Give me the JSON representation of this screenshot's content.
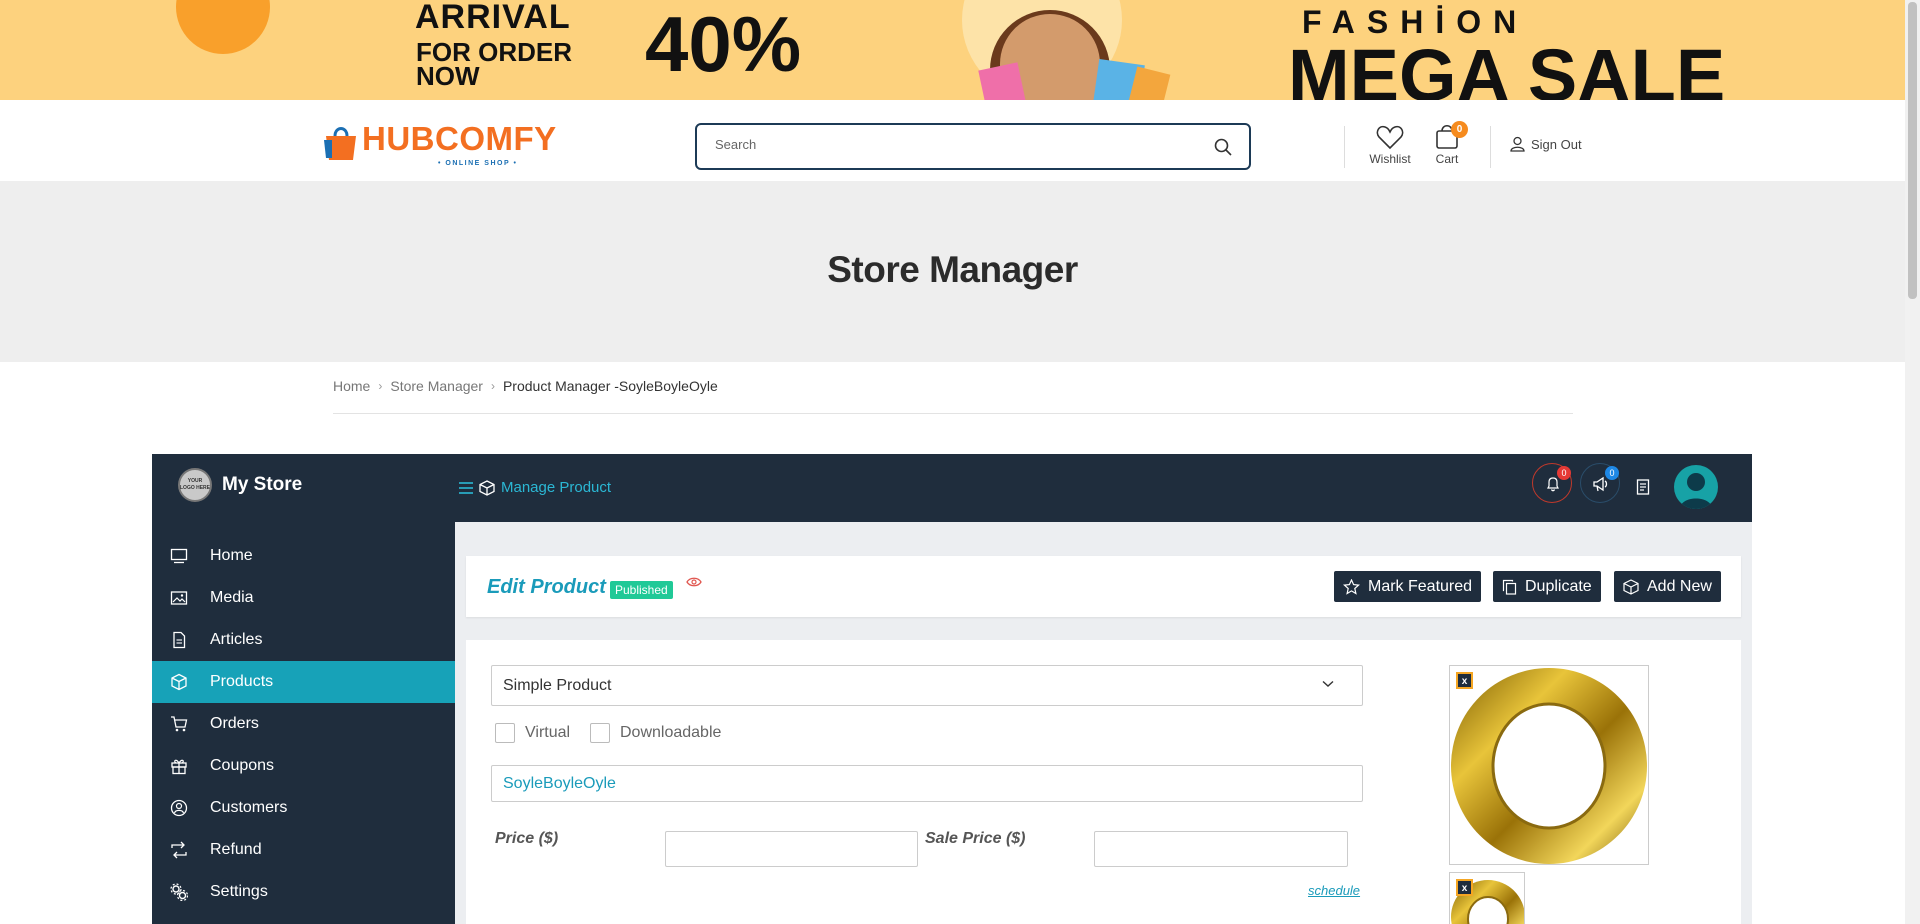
{
  "banner": {
    "arrival": "ARRIVAL",
    "for_order": "FOR ORDER",
    "now": "NOW",
    "discount": "40%",
    "fashion": "FASHİON",
    "mega_sale": "MEGA SALE"
  },
  "header": {
    "logo_text": "HUBCOMFY",
    "logo_subtext": "• ONLINE SHOP •",
    "search_placeholder": "Search",
    "wishlist_label": "Wishlist",
    "cart_label": "Cart",
    "cart_count": "0",
    "signout_label": "Sign Out"
  },
  "page": {
    "title": "Store Manager"
  },
  "breadcrumb": {
    "items": [
      "Home",
      "Store Manager",
      "Product Manager -SoyleBoyleOyle"
    ]
  },
  "topbar": {
    "store_logo_text": "YOUR LOGO HERE",
    "store_name": "My Store",
    "manage_label": "Manage Product",
    "notifications_count": "0",
    "announcements_count": "0"
  },
  "sidebar": {
    "items": [
      {
        "label": "Home",
        "icon": "monitor-icon"
      },
      {
        "label": "Media",
        "icon": "image-icon"
      },
      {
        "label": "Articles",
        "icon": "document-icon"
      },
      {
        "label": "Products",
        "icon": "cube-icon",
        "active": true
      },
      {
        "label": "Orders",
        "icon": "cart-icon"
      },
      {
        "label": "Coupons",
        "icon": "gift-icon"
      },
      {
        "label": "Customers",
        "icon": "user-circle-icon"
      },
      {
        "label": "Refund",
        "icon": "refund-icon"
      },
      {
        "label": "Settings",
        "icon": "gears-icon"
      }
    ]
  },
  "edit": {
    "title": "Edit Product",
    "status": "Published",
    "mark_featured": "Mark Featured",
    "duplicate": "Duplicate",
    "add_new": "Add New"
  },
  "form": {
    "product_type": "Simple Product",
    "virtual_label": "Virtual",
    "downloadable_label": "Downloadable",
    "product_name": "SoyleBoyleOyle",
    "price_label": "Price ($)",
    "price_value": "",
    "sale_price_label": "Sale Price ($)",
    "sale_price_value": "",
    "schedule_label": "schedule",
    "remove_image_label": "x"
  },
  "colors": {
    "banner_bg": "#fdd27e",
    "accent": "#17a2b8",
    "dark": "#1f2d3d",
    "logo_orange": "#f36f21",
    "published": "#20c997"
  }
}
